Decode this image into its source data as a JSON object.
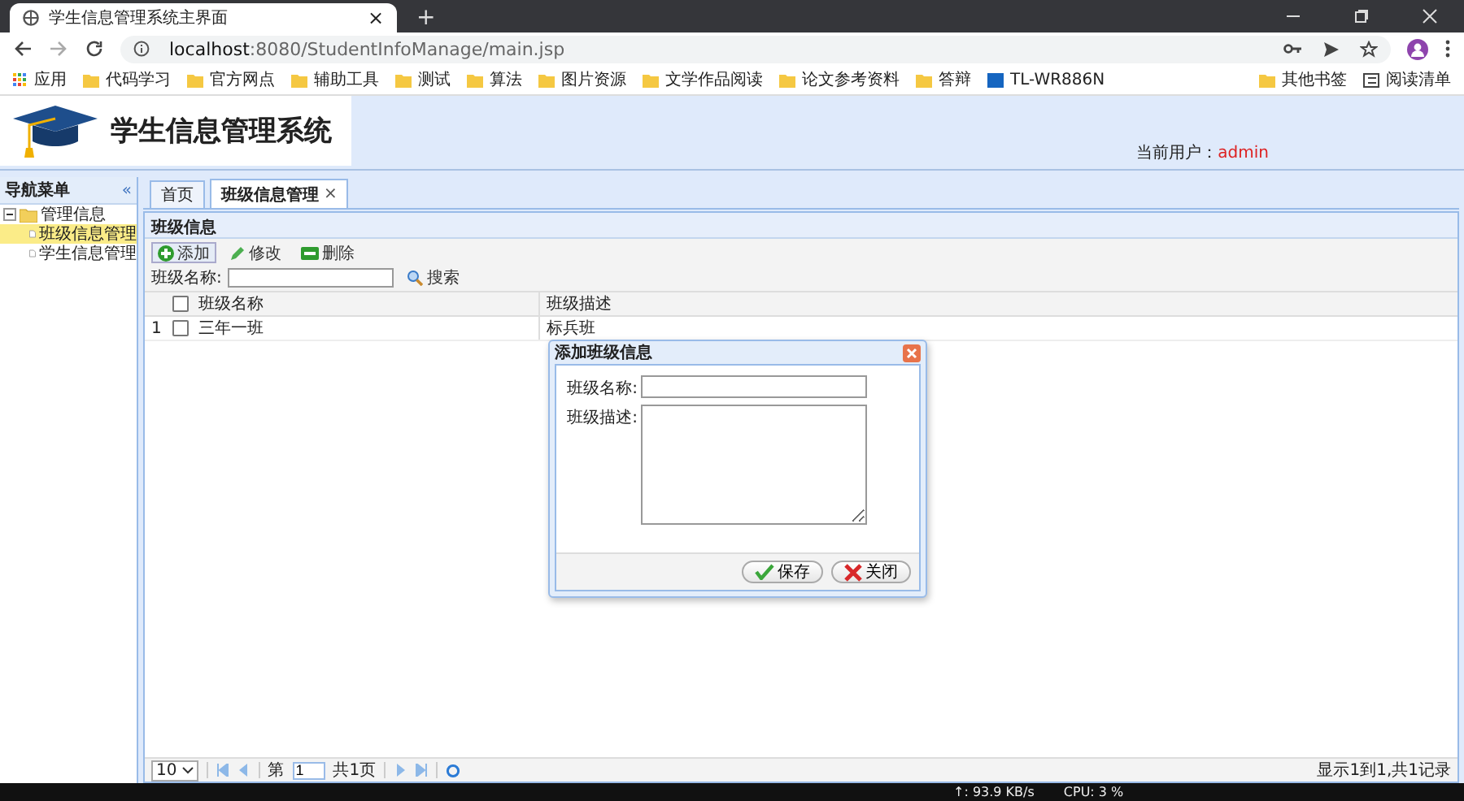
{
  "browser": {
    "tab_title": "学生信息管理系统主界面",
    "tab_close": "×",
    "new_tab": "+",
    "url_host": "localhost",
    "url_rest": ":8080/StudentInfoManage/main.jsp",
    "bookmarks": [
      {
        "label": "应用",
        "kind": "apps"
      },
      {
        "label": "代码学习",
        "kind": "folder"
      },
      {
        "label": "官方网点",
        "kind": "folder"
      },
      {
        "label": "辅助工具",
        "kind": "folder"
      },
      {
        "label": "测试",
        "kind": "folder"
      },
      {
        "label": "算法",
        "kind": "folder"
      },
      {
        "label": "图片资源",
        "kind": "folder"
      },
      {
        "label": "文学作品阅读",
        "kind": "folder"
      },
      {
        "label": "论文参考资料",
        "kind": "folder"
      },
      {
        "label": "答辩",
        "kind": "folder"
      },
      {
        "label": "TL-WR886N",
        "kind": "site"
      }
    ],
    "other_bookmarks": "其他书签",
    "reading_list": "阅读清单"
  },
  "header": {
    "title": "学生信息管理系统",
    "user_label": "当前用户：",
    "user": "admin"
  },
  "nav": {
    "title": "导航菜单",
    "collapse": "«",
    "tree": [
      {
        "label": "管理信息",
        "expanded": true,
        "children": [
          {
            "label": "班级信息管理",
            "selected": true
          },
          {
            "label": "学生信息管理",
            "selected": false
          }
        ]
      }
    ]
  },
  "tabs": [
    {
      "label": "首页",
      "selected": false,
      "closable": false
    },
    {
      "label": "班级信息管理",
      "selected": true,
      "closable": true
    }
  ],
  "tab_close": "×",
  "panel": {
    "title": "班级信息",
    "toolbar": [
      {
        "label": "添加",
        "kind": "add"
      },
      {
        "label": "修改",
        "kind": "edit"
      },
      {
        "label": "删除",
        "kind": "delete"
      }
    ],
    "search_label": "班级名称:",
    "search_button": "搜索",
    "table": {
      "all_checked": false,
      "columns": [
        "班级名称",
        "班级描述"
      ],
      "rows": [
        {
          "index": "1",
          "checked": false,
          "cells": [
            "三年一班",
            "标兵班"
          ]
        }
      ]
    },
    "pager": {
      "page_size": "10",
      "page_prefix": "第",
      "page": "1",
      "total_pages": "共1页",
      "summary": "显示1到1,共1记录"
    }
  },
  "dialog": {
    "title": "添加班级信息",
    "fields": [
      {
        "label": "班级名称:",
        "kind": "input"
      },
      {
        "label": "班级描述:",
        "kind": "textarea"
      }
    ],
    "buttons": [
      {
        "label": "保存",
        "kind": "save"
      },
      {
        "label": "关闭",
        "kind": "close"
      }
    ]
  },
  "taskbar": [
    "↑: 93.9 KB/s",
    "CPU: 3 %"
  ]
}
